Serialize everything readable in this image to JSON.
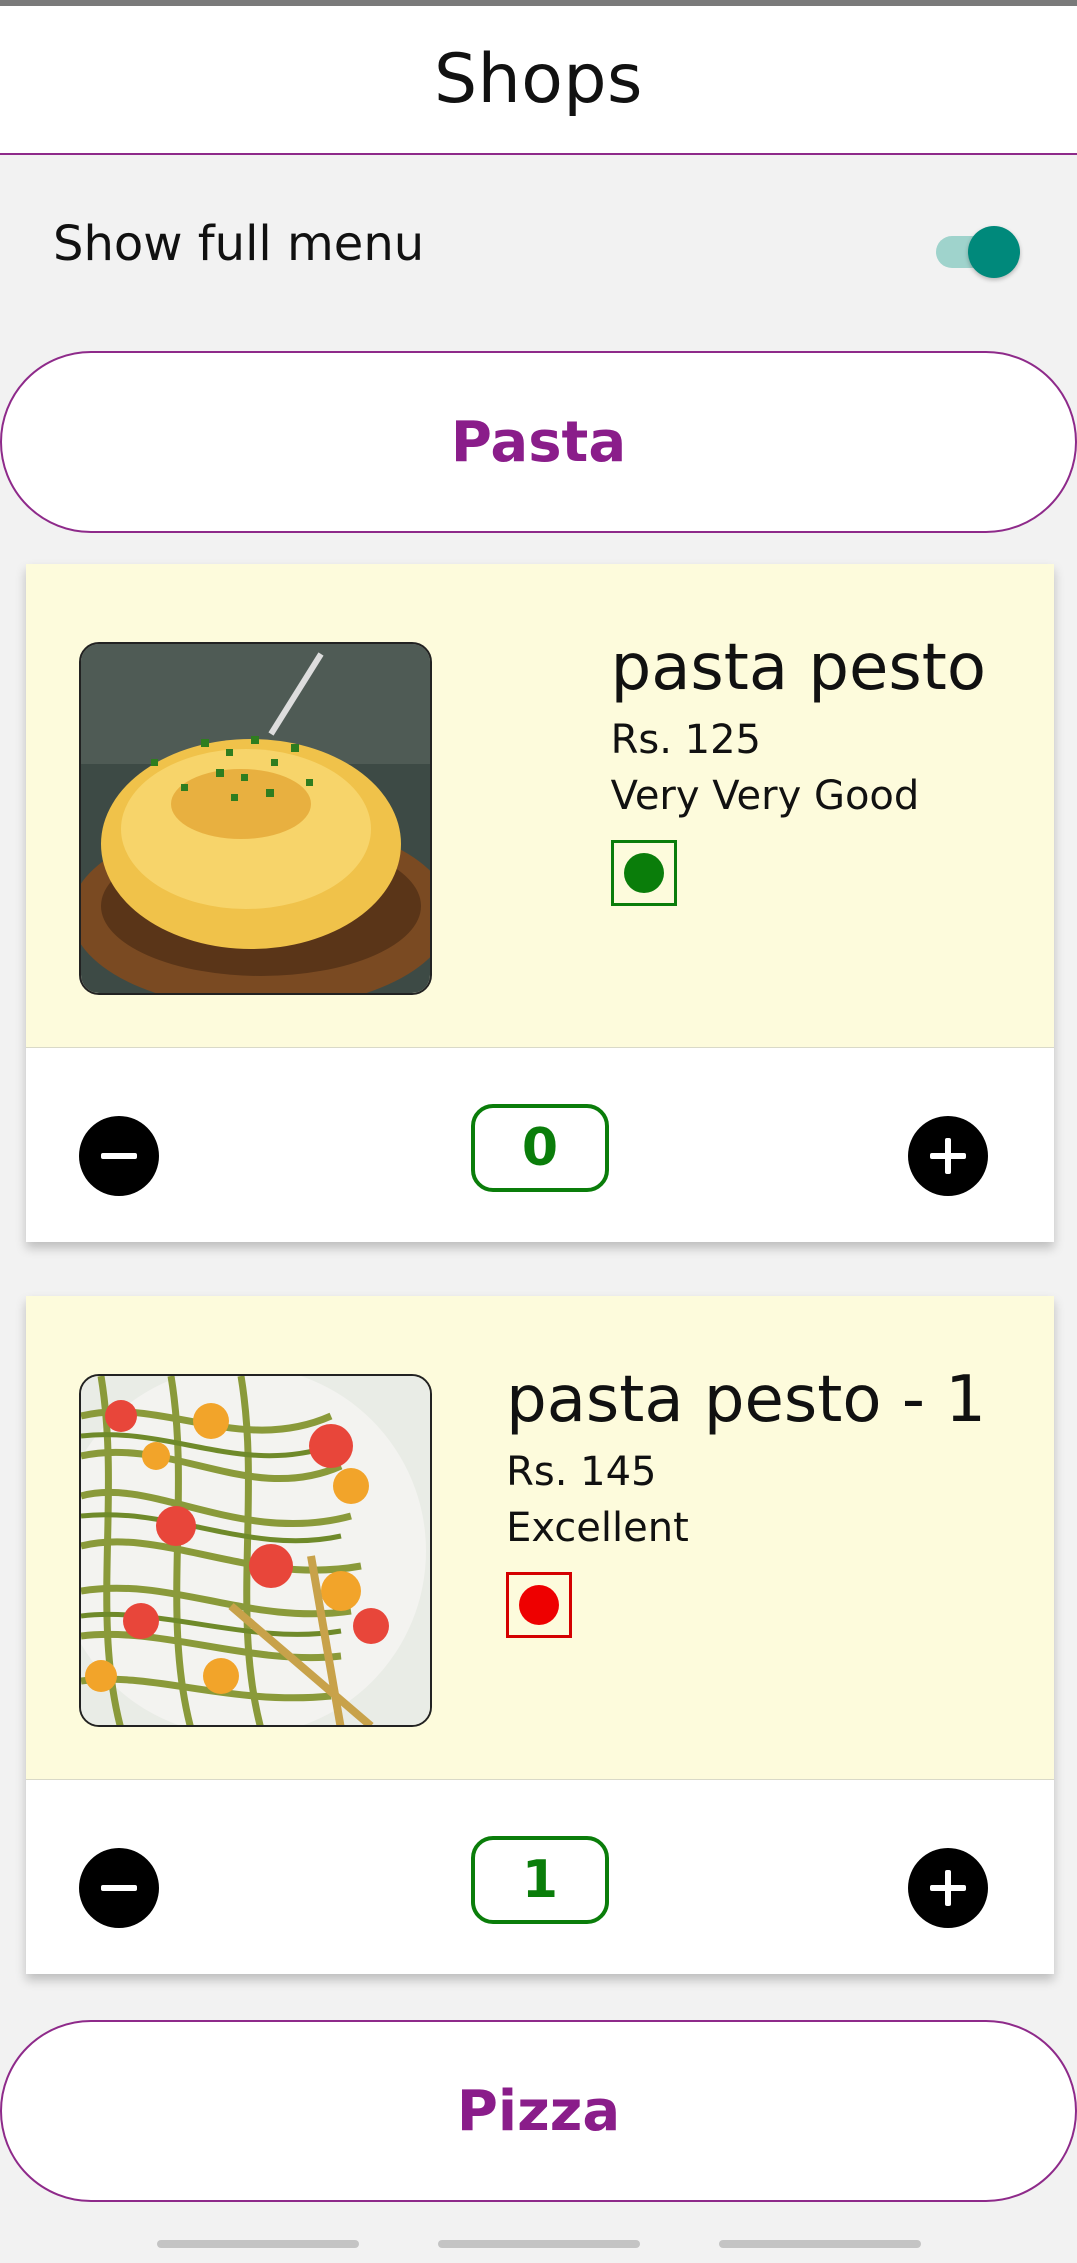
{
  "header": {
    "title": "Shops"
  },
  "toggle": {
    "label": "Show full menu",
    "on": true,
    "accent": "#00897b"
  },
  "categories": [
    {
      "label": "Pasta"
    },
    {
      "label": "Pizza"
    }
  ],
  "items": [
    {
      "name": "pasta pesto",
      "price": "Rs. 125",
      "rating": "Very Very Good",
      "diet": "veg",
      "diet_color": "#0a7d0a",
      "quantity": "0"
    },
    {
      "name": "pasta pesto - 1",
      "price": "Rs. 145",
      "rating": "Excellent",
      "diet": "non-veg",
      "diet_color": "#e00000",
      "quantity": "1"
    }
  ],
  "colors": {
    "brand": "#8a1d8a",
    "card_top": "#fdfbdc",
    "quantity": "#0a7d0a"
  },
  "icons": {
    "decrement": "minus-icon",
    "increment": "plus-icon"
  }
}
